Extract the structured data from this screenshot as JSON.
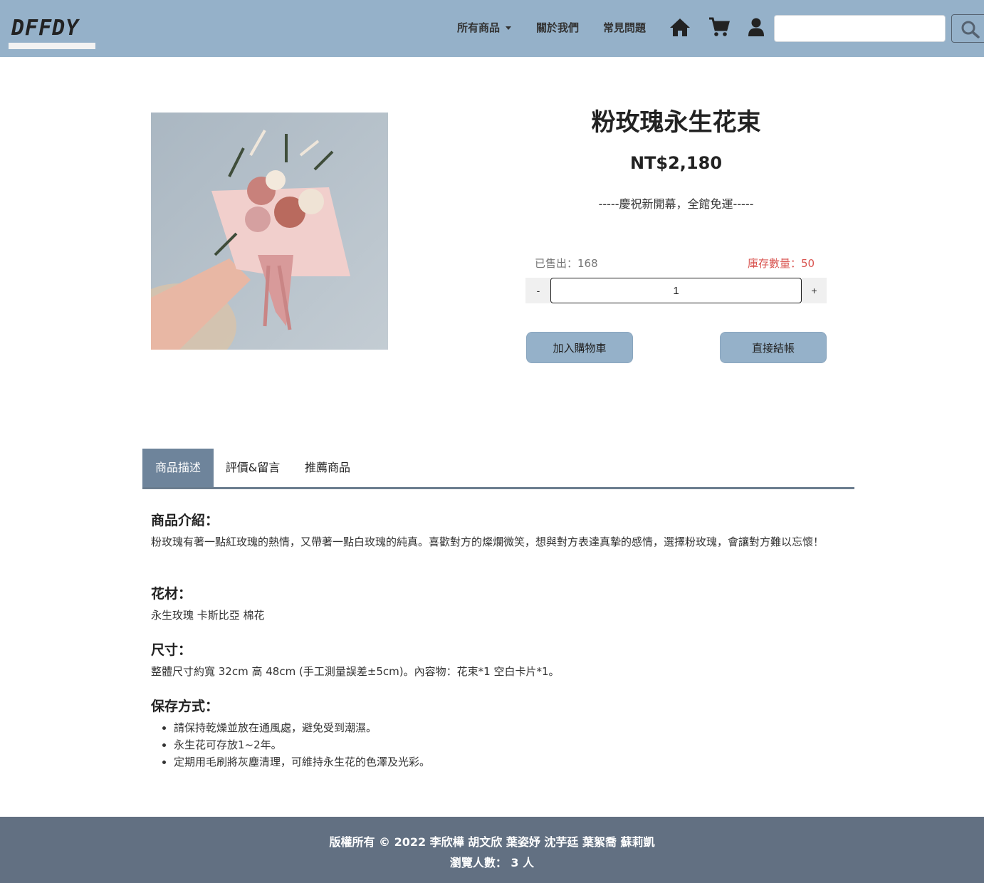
{
  "nav": {
    "logo": "DFFDY",
    "links": [
      "所有商品",
      "關於我們",
      "常見問題"
    ],
    "icons": [
      "home-icon",
      "cart-icon",
      "user-icon"
    ],
    "search_value": "",
    "search_icon": "search-icon"
  },
  "product": {
    "title": "粉玫瑰永生花束",
    "price": "NT$2,180",
    "promo": "-----慶祝新開幕，全館免運-----",
    "sold": "已售出：168",
    "stock": "庫存數量：50",
    "minus": "-",
    "qty": "1",
    "plus": "+",
    "add_to_cart": "加入購物車",
    "checkout": "直接結帳"
  },
  "tabs": [
    "商品描述",
    "評價&留言",
    "推薦商品"
  ],
  "desc": {
    "intro_title": "商品介紹：",
    "intro_text": "粉玫瑰有著一點紅玫瑰的熱情，又帶著一點白玫瑰的純真。喜歡對方的燦爛微笑，想與對方表達真摯的感情，選擇粉玫瑰，會讓對方難以忘懷！",
    "materials_title": "花材：",
    "materials_text": "永生玫瑰 卡斯比亞 棉花",
    "size_title": "尺寸：",
    "size_text": "整體尺寸約寬 32cm 高 48cm (手工測量誤差±5cm)。內容物：花束*1 空白卡片*1。",
    "care_title": "保存方式：",
    "care_items": [
      "請保持乾燥並放在通風處，避免受到潮濕。",
      "永生花可存放1~2年。",
      "定期用毛刷將灰塵清理，可維持永生花的色澤及光彩。"
    ]
  },
  "footer": {
    "copyright": "版權所有 © 2022 李欣樺 胡文欣 葉姿妤 沈芋廷 葉絮喬 蘇莉凱",
    "visitors": "瀏覽人數： 3 人"
  }
}
